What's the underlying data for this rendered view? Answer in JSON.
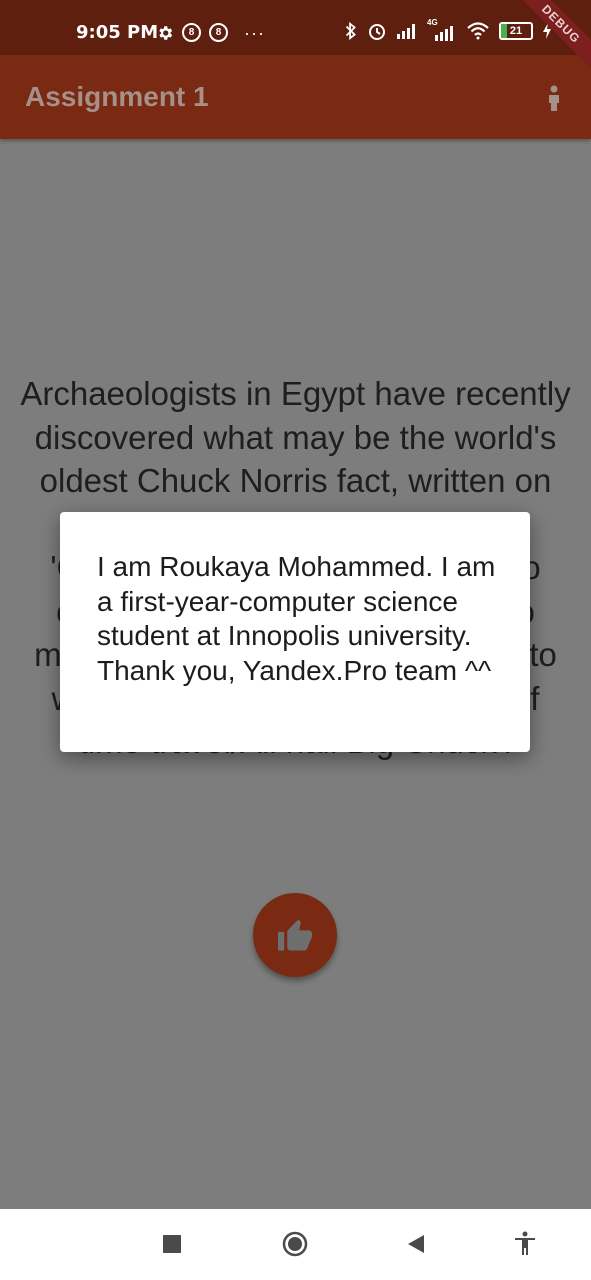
{
  "status_bar": {
    "time": "9:05 PM",
    "badge_1": "8",
    "badge_2": "8",
    "more": "···",
    "network_type": "4G",
    "battery_level": "21",
    "icons": [
      "gear-icon",
      "bluetooth-icon",
      "alarm-icon",
      "signal-icon",
      "signal-4g-icon",
      "wifi-icon",
      "battery-icon",
      "charging-icon"
    ]
  },
  "debug_banner": "DEBUG",
  "app_bar": {
    "title": "Assignment 1",
    "action_icon": "person-icon"
  },
  "main": {
    "fact_text": "Archaeologists in Egypt have recently discovered what may be the world's oldest Chuck Norris fact, written on the inside of a pyramid. It reads 'Chuck Norris Is the only one who can make it go bare feet, he who made the pyramids 1/ Ra told me to write this/ Big Chuck is the lord of time travel/All hail Big Chuck'.",
    "like_icon": "thumb-up-icon"
  },
  "dialog": {
    "text": "I am Roukaya Mohammed. I am a first-year-computer science student at Innopolis university. Thank you, Yandex.Pro team ^^"
  },
  "nav_bar": {
    "icons": [
      "recents-square-icon",
      "home-circle-icon",
      "back-triangle-icon",
      "accessibility-icon"
    ]
  },
  "colors": {
    "status_bar": "#5e1f0e",
    "app_bar": "#7a2a12",
    "scrim_background": "#7d7d7d",
    "dialog": "#ffffff",
    "accent": "#7a2a12"
  }
}
